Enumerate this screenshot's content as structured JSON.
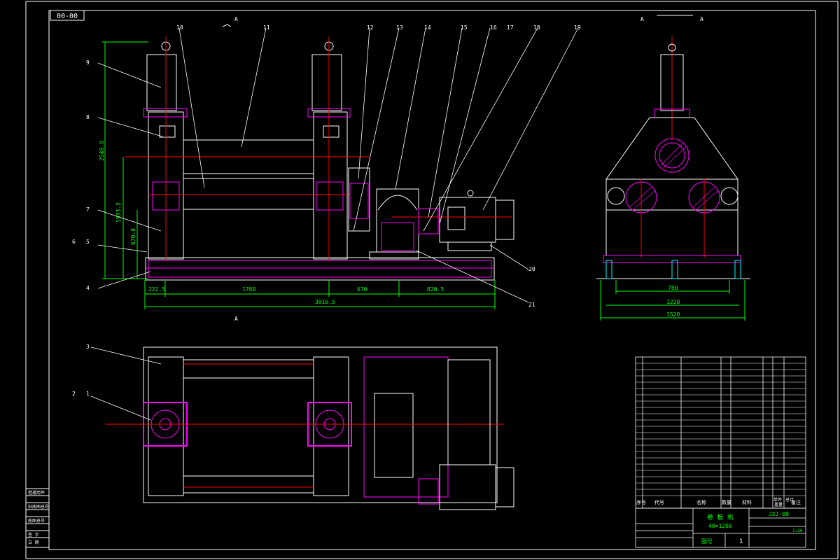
{
  "drawing": {
    "code_box": "00-00",
    "section_marks": {
      "top_a": "A",
      "bottom_a": "A",
      "side_left": "A",
      "side_right": "A"
    },
    "balloons": [
      "10",
      "11",
      "12",
      "13",
      "14",
      "15",
      "16",
      "17",
      "18",
      "19",
      "9",
      "8",
      "7",
      "6",
      "5",
      "4",
      "3",
      "1",
      "2",
      "20",
      "21"
    ],
    "dimensions": {
      "height_total": "2548.8",
      "height_mid": "1933.2",
      "height_low": "670.8",
      "seg1": "222.5",
      "seg2": "1760",
      "seg3": "670",
      "seg4": "820.5",
      "overall": "3016.5",
      "side_inner": "780",
      "side_mid": "1220",
      "side_outer": "1520"
    },
    "bom_header": {
      "no": "序号",
      "code": "代号",
      "name": "名称",
      "qty": "数量",
      "material": "材料",
      "unit_weight": "单件",
      "total_weight": "总计",
      "weight": "重量",
      "remark": "备注"
    },
    "title_block": {
      "title": "卷 板 机",
      "subtitle": "40×1260",
      "drawing_no": "JXJ-00",
      "scale": "1:20",
      "sheet": "1",
      "sheet_label": "图号"
    },
    "stamp_labels": [
      "借通用件",
      "",
      "旧底图总号",
      "",
      "底图总号",
      "",
      "签 字",
      "日 期"
    ]
  },
  "colors": {
    "background": "#000000",
    "frame": "#ffffff",
    "outline": "#ffffff",
    "part": "#ff00ff",
    "dimension": "#00ff00",
    "center_line": "#ff0000",
    "hidden": "#00ffff",
    "hatch": "#ff00ff"
  }
}
